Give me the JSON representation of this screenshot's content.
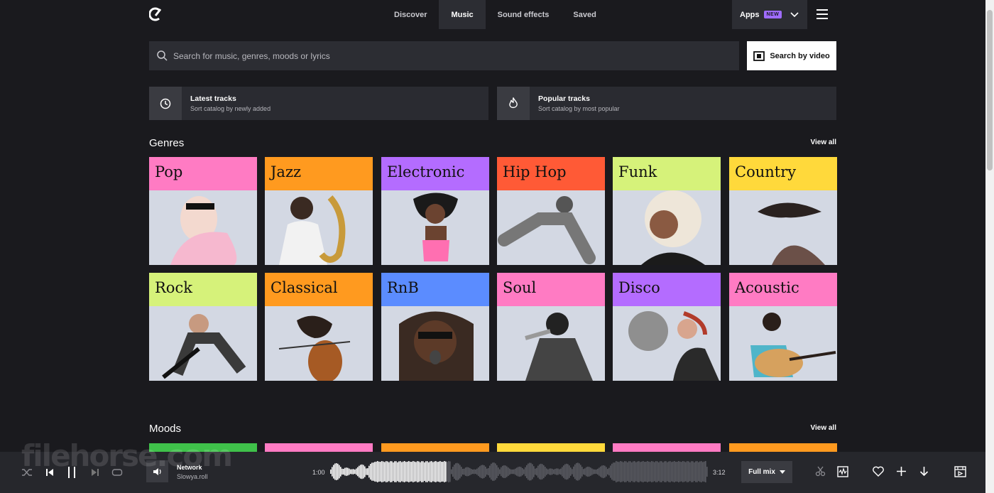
{
  "nav": {
    "items": [
      {
        "label": "Discover",
        "active": false
      },
      {
        "label": "Music",
        "active": true
      },
      {
        "label": "Sound effects",
        "active": false
      },
      {
        "label": "Saved",
        "active": false
      }
    ],
    "apps_label": "Apps",
    "apps_badge": "NEW"
  },
  "search": {
    "placeholder": "Search for music, genres, moods or lyrics",
    "video_button": "Search by video"
  },
  "sort_cards": [
    {
      "title": "Latest tracks",
      "subtitle": "Sort catalog by newly added",
      "icon": "clock-icon"
    },
    {
      "title": "Popular tracks",
      "subtitle": "Sort catalog by most popular",
      "icon": "flame-icon"
    }
  ],
  "genres": {
    "title": "Genres",
    "view_all": "View all",
    "items": [
      {
        "label": "Pop",
        "color": "#ff7bc3"
      },
      {
        "label": "Jazz",
        "color": "#ff9a1f"
      },
      {
        "label": "Electronic",
        "color": "#b46cff"
      },
      {
        "label": "Hip Hop",
        "color": "#ff5a36"
      },
      {
        "label": "Funk",
        "color": "#d6f27a"
      },
      {
        "label": "Country",
        "color": "#ffd93b"
      },
      {
        "label": "Rock",
        "color": "#d6f27a"
      },
      {
        "label": "Classical",
        "color": "#ff9a1f"
      },
      {
        "label": "RnB",
        "color": "#5b8cff"
      },
      {
        "label": "Soul",
        "color": "#ff7bc3"
      },
      {
        "label": "Disco",
        "color": "#b46cff"
      },
      {
        "label": "Acoustic",
        "color": "#ff7bc3"
      }
    ]
  },
  "moods": {
    "title": "Moods",
    "view_all": "View all",
    "colors": [
      "#3fc14a",
      "#ff7bc3",
      "#ff9a1f",
      "#ffd93b",
      "#ff7bc3",
      "#ff9a1f"
    ]
  },
  "player": {
    "track_title": "Network",
    "track_artist": "Slowya.roll",
    "current_time": "1:00",
    "total_time": "3:12",
    "mix_label": "Full mix",
    "progress": 0.31
  },
  "watermark": "filehorse.com"
}
